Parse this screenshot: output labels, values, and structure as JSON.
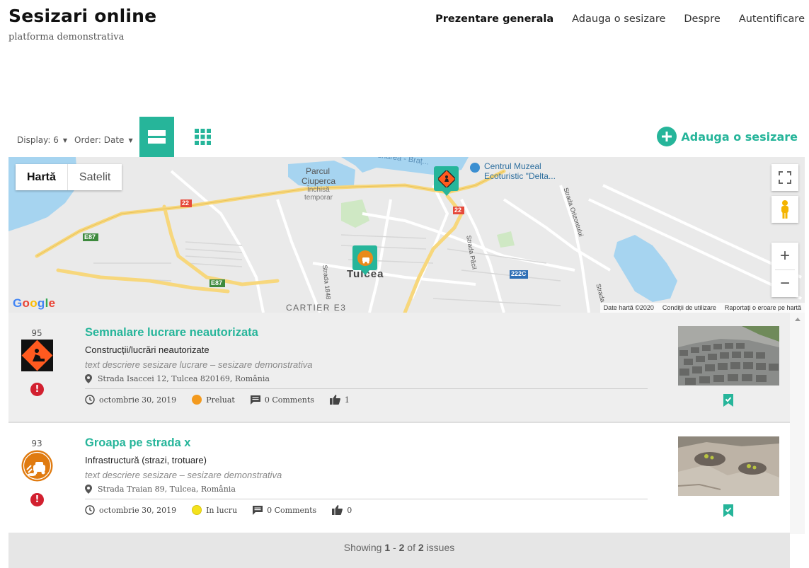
{
  "header": {
    "title": "Sesizari online",
    "tagline": "platforma demonstrativa",
    "nav": [
      {
        "label": "Prezentare generala",
        "active": true
      },
      {
        "label": "Adauga o sesizare",
        "active": false
      },
      {
        "label": "Despre",
        "active": false
      },
      {
        "label": "Autentificare",
        "active": false
      }
    ]
  },
  "toolbar": {
    "display_label": "Display: 6",
    "order_label": "Order: Date",
    "add_label": "Adauga o sesizare",
    "accent": "#26b59a"
  },
  "map": {
    "type_map": "Hartă",
    "type_satellite": "Satelit",
    "google": "Google",
    "footer": [
      "Date hartă ©2020",
      "Condiții de utilizare",
      "Raportați o eroare pe hartă"
    ],
    "labels": {
      "parc": "Parcul",
      "ciuperca": "Ciuperca",
      "inchisa": "Închisă",
      "temporar": "temporar",
      "muzeu1": "Centrul Muzeal",
      "muzeu2": "Ecoturistic \"Delta...",
      "dunarea": "Dunarea - Braț...",
      "tulcea": "Tulcea",
      "cartier": "CARTIER E3",
      "e87a": "E87",
      "e87b": "E87",
      "r22a": "22",
      "r22b": "22",
      "r222c": "222C",
      "pacii": "Strada Păcii",
      "orizontului": "Strada Orizontului",
      "s1848": "Strada 1848",
      "strada": "Strada"
    }
  },
  "issues": [
    {
      "number": "95",
      "title": "Semnalare lucrare neautorizata",
      "category": "Construcții/lucrări neautorizate",
      "description": "text descriere sesizare lucrare – sesizare demonstrativa",
      "address": "Strada Isaccei 12, Tulcea 820169, România",
      "date": "octombrie 30, 2019",
      "status": "Preluat",
      "status_color": "#f39a1e",
      "comments": "0 Comments",
      "likes": "1",
      "icon": "construction-icon"
    },
    {
      "number": "93",
      "title": "Groapa pe strada x",
      "category": "Infrastructură (strazi, trotuare)",
      "description": "text descriere sesizare – sesizare demonstrativa",
      "address": "Strada Traian 89, Tulcea, România",
      "date": "octombrie 30, 2019",
      "status": "In lucru",
      "status_color": "#f4e21c",
      "comments": "0 Comments",
      "likes": "0",
      "icon": "pothole-icon"
    }
  ],
  "pager": {
    "prefix": "Showing ",
    "from": "1",
    "dash": " - ",
    "to": "2",
    "of": " of ",
    "total": "2",
    "suffix": " issues"
  }
}
